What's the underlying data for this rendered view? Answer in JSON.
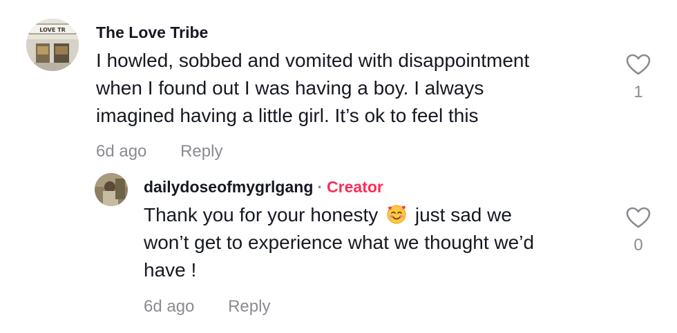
{
  "comment": {
    "username": "The Love Tribe",
    "avatar_sign": "LOVE TR",
    "lines": [
      "I howled, sobbed and vomited with disappointment",
      "when I found out I was having a boy. I always",
      "imagined having a little girl. It’s ok to feel this"
    ],
    "time": "6d ago",
    "reply_label": "Reply",
    "like_count": "1",
    "like_icon": "heart-outline-icon"
  },
  "reply": {
    "username": "dailydoseofmygrlgang",
    "separator": "·",
    "badge": "Creator",
    "line1_before_emoji": "Thank you for your honesty",
    "emoji": "smiling-face-with-hearts",
    "line1_after_emoji": "just sad we",
    "lines_rest": [
      "won’t get to experience what we thought we’d",
      "have !"
    ],
    "time": "6d ago",
    "reply_label": "Reply",
    "like_count": "0",
    "like_icon": "heart-outline-icon"
  },
  "colors": {
    "text": "#161823",
    "muted": "#8a8b91",
    "creator": "#fe2c55"
  }
}
